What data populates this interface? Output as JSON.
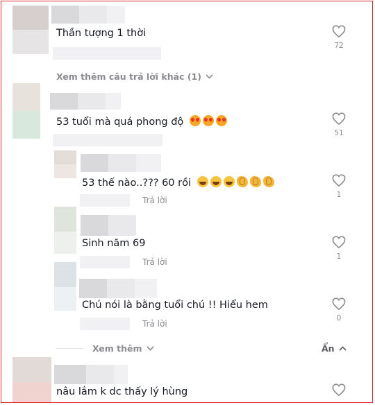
{
  "comments": [
    {
      "text": "Thần tượng 1 thời",
      "likes": "72"
    },
    {
      "text": "53 tuổi mà quá phong độ",
      "likes": "51",
      "emojis": [
        "heart-eyes-emoji",
        "heart-eyes-emoji",
        "heart-eyes-emoji"
      ]
    },
    {
      "text": "nâu lắm k dc thấy lý hùng"
    }
  ],
  "replies": [
    {
      "text": "53 thế nào..??? 60 rồi",
      "likes": "1",
      "reply_label": "Trả lời",
      "emojis": [
        "laughing-emoji",
        "laughing-emoji",
        "laughing-emoji",
        "clapping-emoji",
        "clapping-emoji",
        "clapping-emoji"
      ]
    },
    {
      "text": "Sinh năm 69",
      "likes": "1",
      "reply_label": "Trả lời"
    },
    {
      "text": "Chú nói là bằng tuổi chú !! Hiểu hem",
      "likes": "0",
      "reply_label": "Trả lời"
    }
  ],
  "view_more_replies": "Xem thêm câu trả lời khác (1)",
  "view_more": "Xem thêm",
  "hide": "Ẩn",
  "colors": {
    "frame": "#e0262b",
    "muted": "#8a8b91",
    "text": "#161823"
  }
}
